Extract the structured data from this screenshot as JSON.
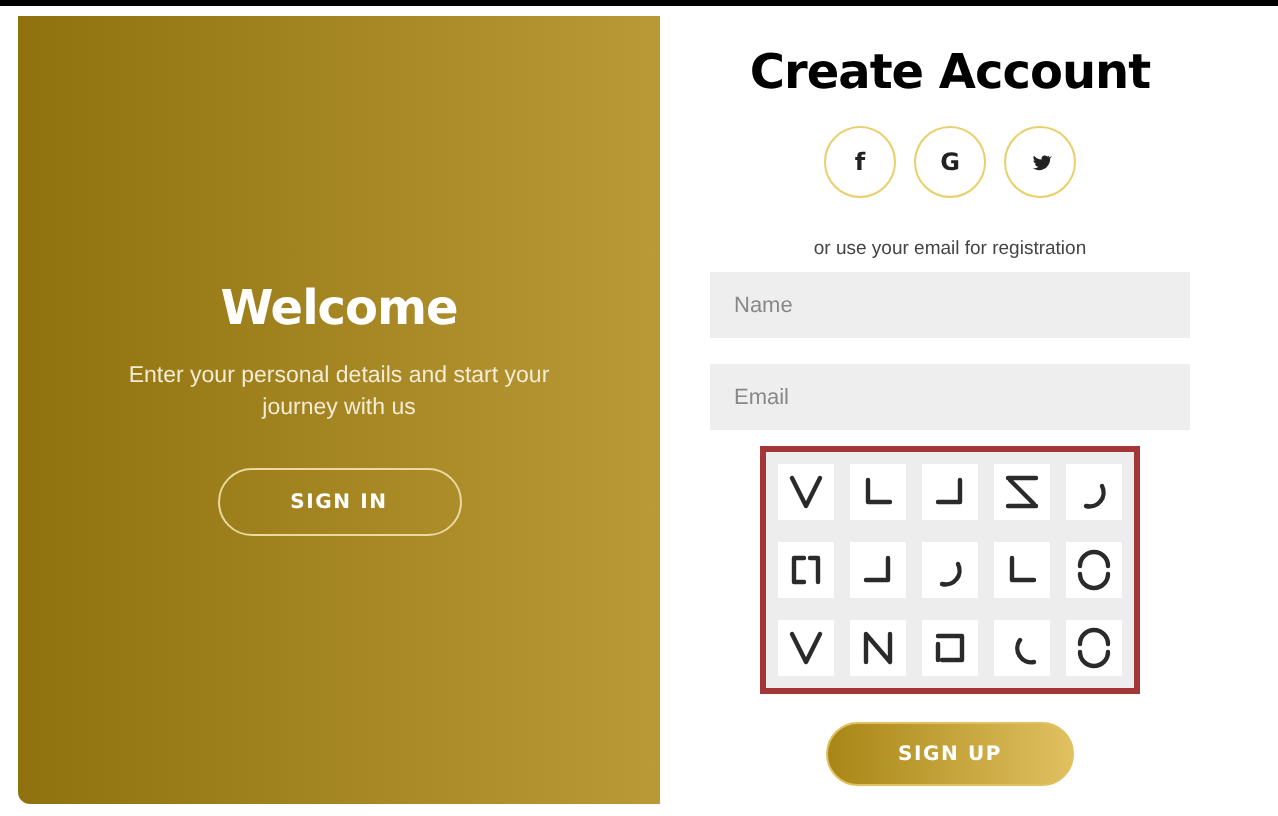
{
  "welcome_panel": {
    "title": "Welcome",
    "message": "Enter your personal details and start your journey with us",
    "button": "SIGN IN"
  },
  "signup_panel": {
    "title": "Create Account",
    "social_buttons": [
      {
        "kind": "letter",
        "label": "f"
      },
      {
        "kind": "letter",
        "label": "G"
      },
      {
        "kind": "bird"
      }
    ],
    "hint": "or use your email for registration",
    "fields": [
      {
        "placeholder": "Name"
      },
      {
        "placeholder": "Email"
      }
    ],
    "captcha_tiles": [
      {
        "kind": "v"
      },
      {
        "kind": "corner-left"
      },
      {
        "kind": "corner-right"
      },
      {
        "kind": "z"
      },
      {
        "kind": "hook"
      },
      {
        "kind": "bracket"
      },
      {
        "kind": "corner-right"
      },
      {
        "kind": "hook"
      },
      {
        "kind": "corner-left"
      },
      {
        "kind": "ring"
      },
      {
        "kind": "v"
      },
      {
        "kind": "n"
      },
      {
        "kind": "square"
      },
      {
        "kind": "arc"
      },
      {
        "kind": "ring"
      }
    ],
    "button": "SIGN UP"
  }
}
